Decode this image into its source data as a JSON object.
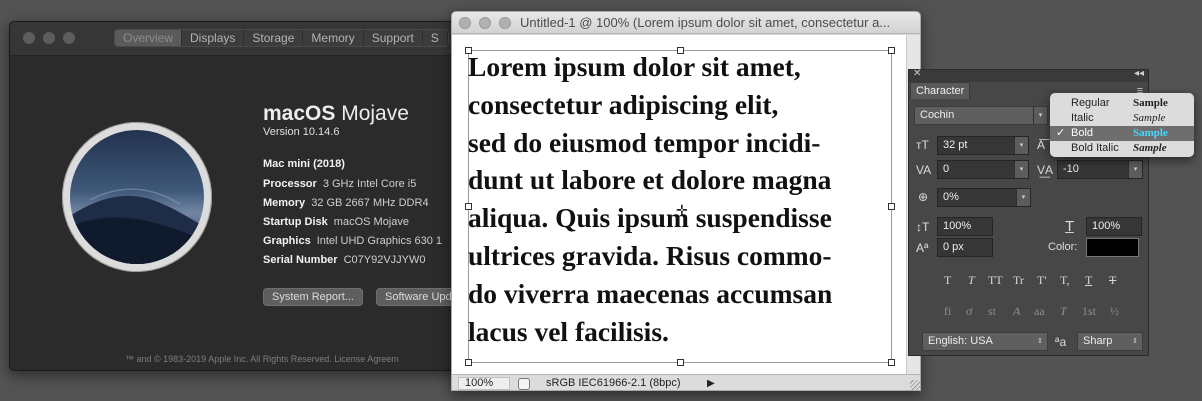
{
  "about": {
    "tabs": [
      "Overview",
      "Displays",
      "Storage",
      "Memory",
      "Support",
      "S"
    ],
    "os_name": "macOS",
    "os_release": "Mojave",
    "version": "Version 10.14.6",
    "model": "Mac mini (2018)",
    "specs": [
      {
        "key": "Processor",
        "value": "3 GHz Intel Core i5"
      },
      {
        "key": "Memory",
        "value": "32 GB 2667 MHz DDR4"
      },
      {
        "key": "Startup Disk",
        "value": "macOS Mojave"
      },
      {
        "key": "Graphics",
        "value": "Intel UHD Graphics 630 1"
      },
      {
        "key": "Serial Number",
        "value": "C07Y92VJJYW0"
      }
    ],
    "system_report_button": "System Report...",
    "software_update_button": "Software Upd",
    "footer": "™ and © 1983-2019 Apple Inc. All Rights Reserved. License Agreem"
  },
  "document": {
    "title": "Untitled-1 @ 100% (Lorem ipsum dolor sit amet, consectetur a...",
    "text_lines": [
      "Lorem ipsum dolor sit amet,",
      "consectetur adipiscing elit,",
      "sed do eiusmod tempor incidi-",
      "dunt ut labore et dolore magna",
      "aliqua. Quis ipsum suspendisse",
      "ultrices gravida. Risus commo-",
      "do viverra maecenas accumsan",
      "lacus vel facilisis."
    ],
    "status_zoom": "100%",
    "status_profile": "sRGB IEC61966-2.1 (8bpc)"
  },
  "character_panel": {
    "tab": "Character",
    "font_family": "Cochin",
    "font_size": "32 pt",
    "kerning": "0",
    "tracking": "-10",
    "tsume": "0%",
    "vertical_scale": "100%",
    "horizontal_scale": "100%",
    "baseline_shift": "0 px",
    "color_label": "Color:",
    "text_color": "#000000",
    "type_buttons": [
      "T",
      "T",
      "TT",
      "Tr",
      "T'",
      "T,",
      "T",
      "T"
    ],
    "opentype_buttons": [
      "fi",
      "ơ",
      "st",
      "A",
      "aa",
      "T",
      "1st",
      "½"
    ],
    "language": "English: USA",
    "aa_label": "ªa",
    "antialias": "Sharp"
  },
  "style_menu": {
    "items": [
      {
        "name": "Regular",
        "sample": "Sample",
        "selected": false
      },
      {
        "name": "Italic",
        "sample": "Sample",
        "selected": false
      },
      {
        "name": "Bold",
        "sample": "Sample",
        "selected": true
      },
      {
        "name": "Bold Italic",
        "sample": "Sample",
        "selected": false
      }
    ],
    "check": "✓"
  }
}
